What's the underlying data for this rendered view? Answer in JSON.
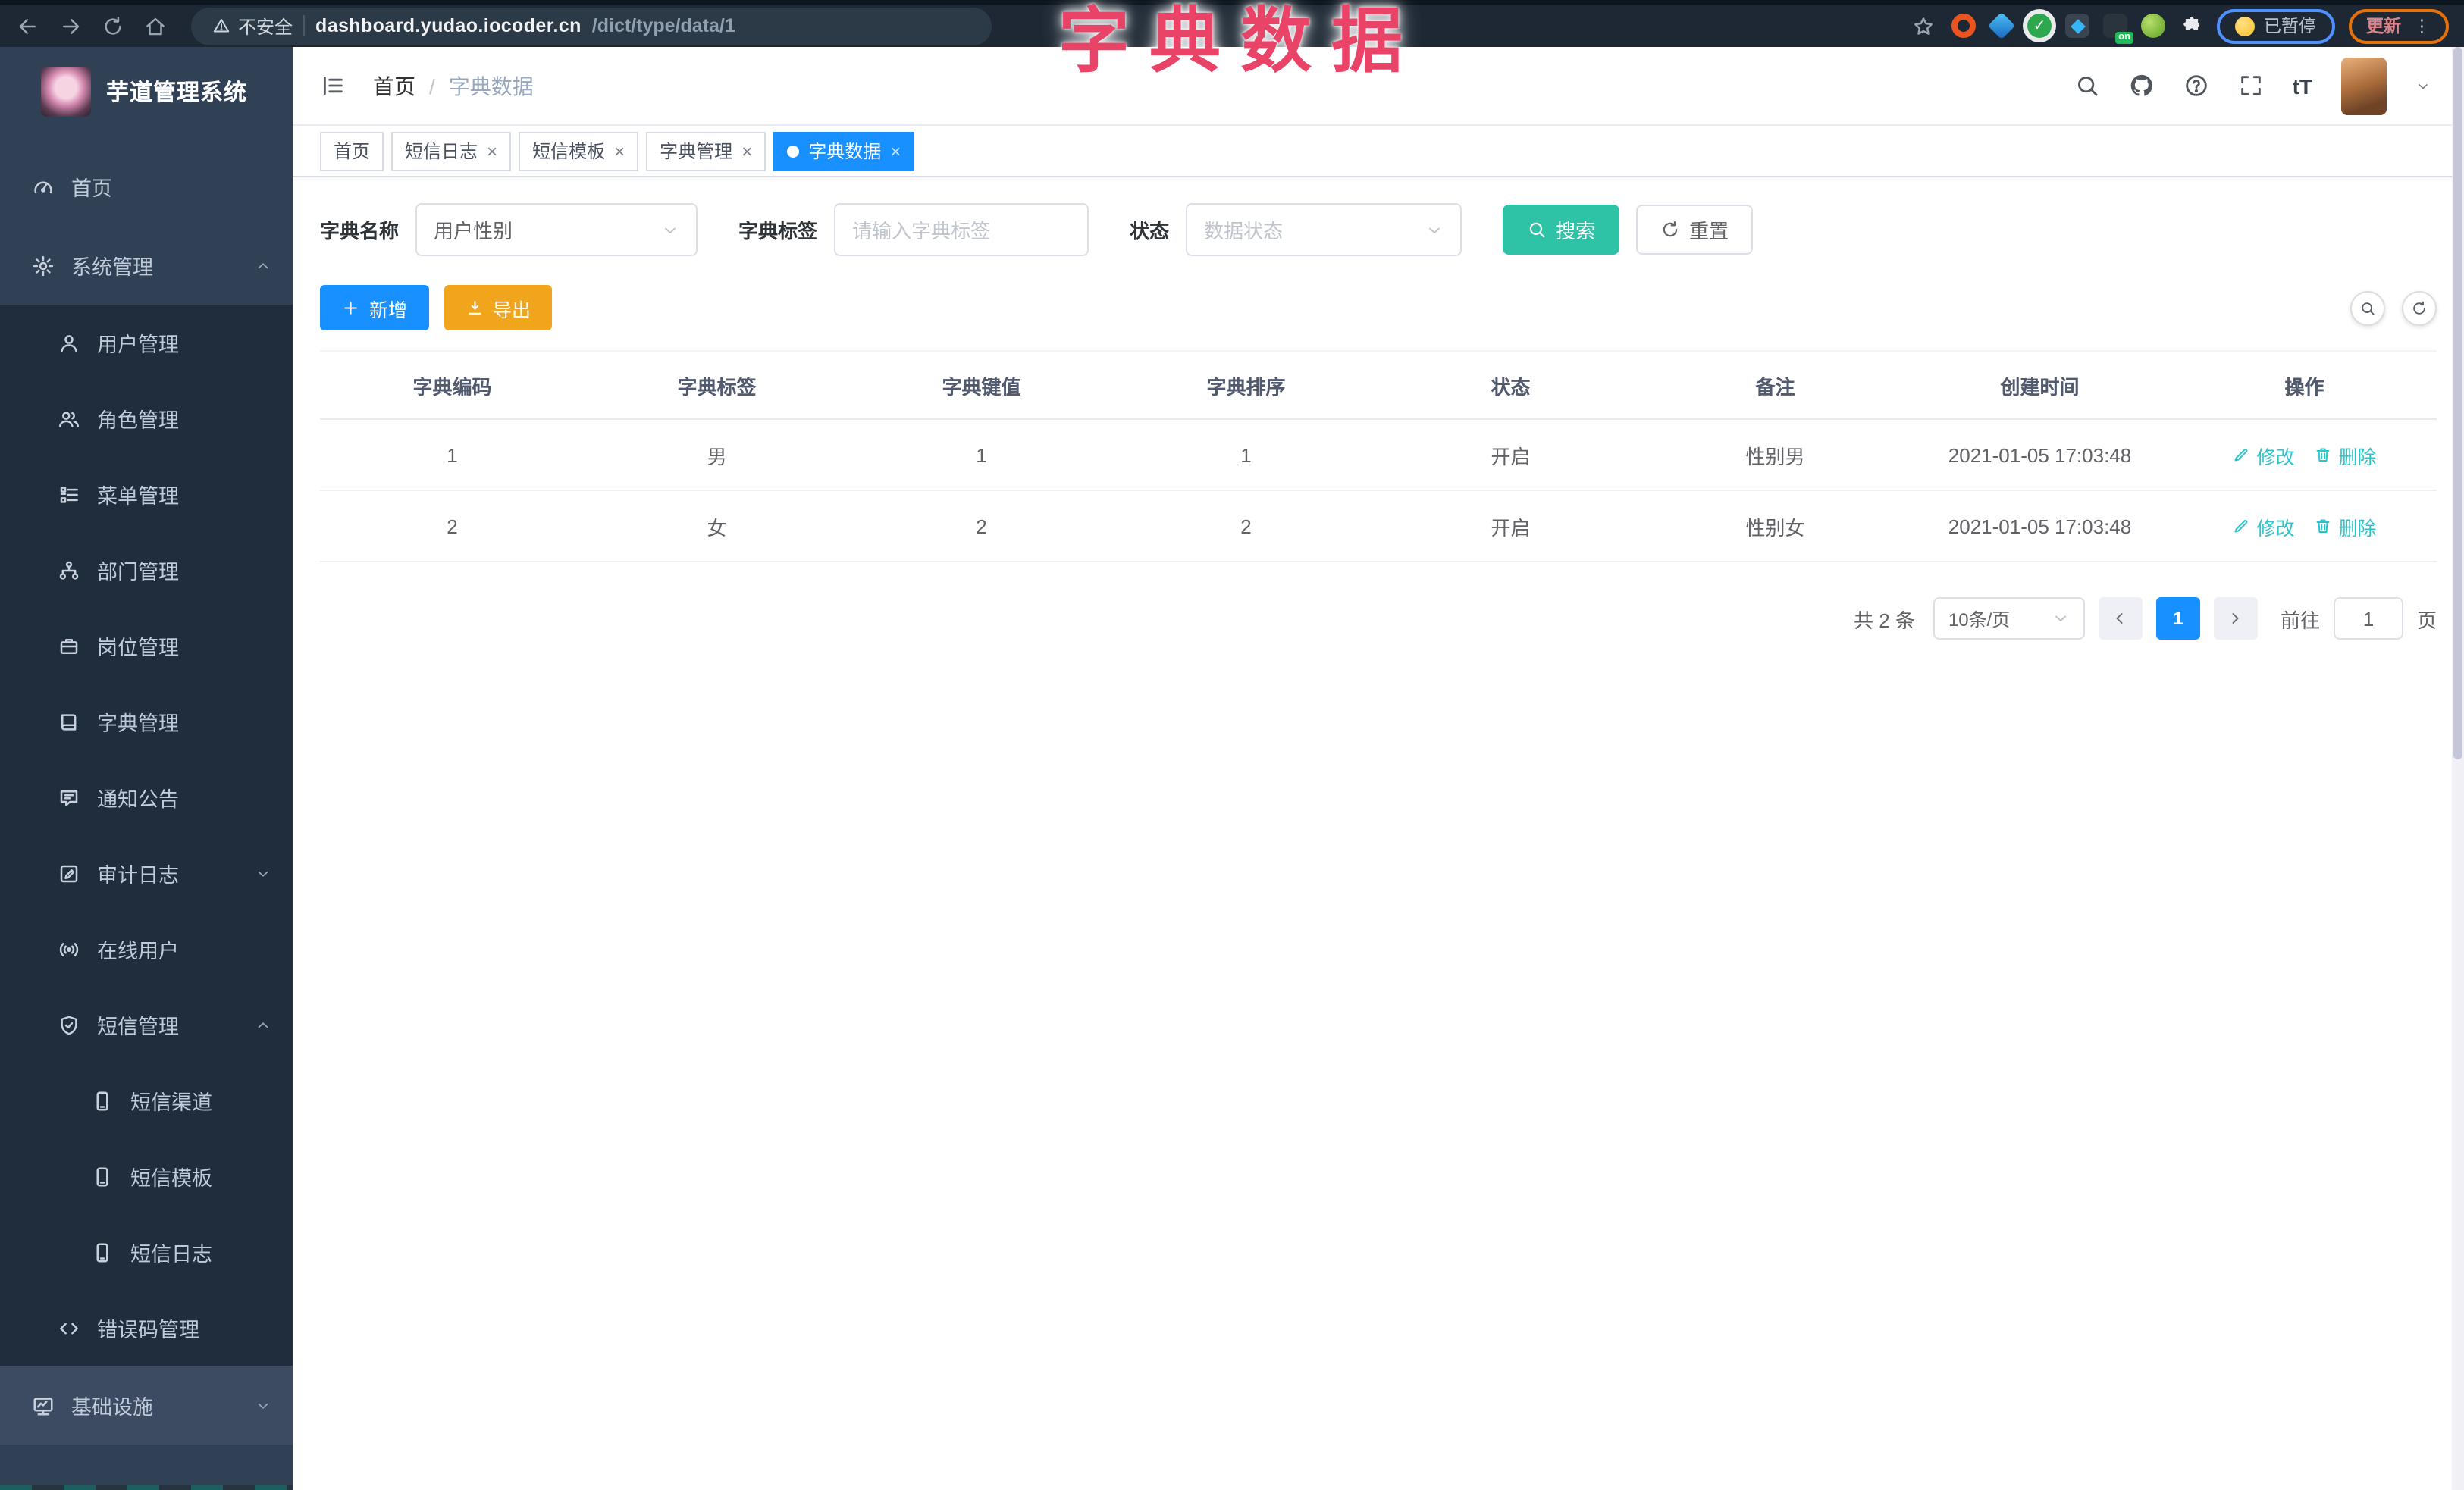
{
  "browser": {
    "security_label": "不安全",
    "url_host": "dashboard.yudao.iocoder.cn",
    "url_path": "/dict/type/data/1",
    "paused_badge": "已暂停",
    "update_badge": "更新",
    "on_badge": "on"
  },
  "overlay_title": "字典数据",
  "sidebar": {
    "app_title": "芋道管理系统",
    "items": [
      {
        "label": "首页",
        "icon": "dashboard-icon",
        "level": 1
      },
      {
        "label": "系统管理",
        "icon": "gear-icon",
        "level": 1,
        "caret": "up"
      },
      {
        "label": "用户管理",
        "icon": "user-icon",
        "level": 2
      },
      {
        "label": "角色管理",
        "icon": "users-icon",
        "level": 2
      },
      {
        "label": "菜单管理",
        "icon": "menu-list-icon",
        "level": 2
      },
      {
        "label": "部门管理",
        "icon": "org-tree-icon",
        "level": 2
      },
      {
        "label": "岗位管理",
        "icon": "briefcase-icon",
        "level": 2
      },
      {
        "label": "字典管理",
        "icon": "book-icon",
        "level": 2
      },
      {
        "label": "通知公告",
        "icon": "bulletin-icon",
        "level": 2
      },
      {
        "label": "审计日志",
        "icon": "audit-log-icon",
        "level": 2,
        "caret": "down"
      },
      {
        "label": "在线用户",
        "icon": "online-icon",
        "level": 2
      },
      {
        "label": "短信管理",
        "icon": "shield-icon",
        "level": 2,
        "caret": "up"
      },
      {
        "label": "短信渠道",
        "icon": "phone-icon",
        "level": 3
      },
      {
        "label": "短信模板",
        "icon": "phone-icon",
        "level": 3
      },
      {
        "label": "短信日志",
        "icon": "phone-icon",
        "level": 3
      },
      {
        "label": "错误码管理",
        "icon": "code-icon",
        "level": 2
      },
      {
        "label": "基础设施",
        "icon": "monitor-icon",
        "level": 1,
        "caret": "down",
        "highlight": true
      }
    ]
  },
  "header": {
    "breadcrumb_home": "首页",
    "breadcrumb_current": "字典数据"
  },
  "tabs": [
    {
      "label": "首页",
      "closable": false,
      "active": false
    },
    {
      "label": "短信日志",
      "closable": true,
      "active": false
    },
    {
      "label": "短信模板",
      "closable": true,
      "active": false
    },
    {
      "label": "字典管理",
      "closable": true,
      "active": false
    },
    {
      "label": "字典数据",
      "closable": true,
      "active": true
    }
  ],
  "filters": {
    "dict_name_label": "字典名称",
    "dict_name_value": "用户性别",
    "dict_label_label": "字典标签",
    "dict_label_placeholder": "请输入字典标签",
    "status_label": "状态",
    "status_placeholder": "数据状态",
    "search_button": "搜索",
    "reset_button": "重置"
  },
  "toolbar": {
    "add_button": "新增",
    "export_button": "导出"
  },
  "table": {
    "columns": [
      "字典编码",
      "字典标签",
      "字典键值",
      "字典排序",
      "状态",
      "备注",
      "创建时间",
      "操作"
    ],
    "rows": [
      {
        "code": "1",
        "label": "男",
        "value": "1",
        "sort": "1",
        "status": "开启",
        "remark": "性别男",
        "created": "2021-01-05 17:03:48"
      },
      {
        "code": "2",
        "label": "女",
        "value": "2",
        "sort": "2",
        "status": "开启",
        "remark": "性别女",
        "created": "2021-01-05 17:03:48"
      }
    ],
    "edit_label": "修改",
    "delete_label": "删除"
  },
  "pagination": {
    "total_text": "共 2 条",
    "page_size": "10条/页",
    "current_page": "1",
    "goto_label": "前往",
    "goto_value": "1",
    "page_suffix": "页"
  },
  "colors": {
    "primary_blue": "#1890ff",
    "search_teal": "#2ec3a6",
    "action_link_cyan": "#2ec3c9",
    "export_orange": "#f0a51d",
    "overlay_pink": "#e94368",
    "sidebar_bg": "#304156",
    "sidebar_submenu_bg": "#1f2d3d",
    "browser_bar_bg": "#1d2834"
  }
}
